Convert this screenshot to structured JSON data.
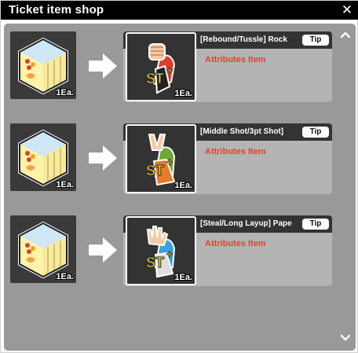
{
  "window": {
    "title": "Ticket item shop",
    "close_symbol": "✕"
  },
  "exchanges": [
    {
      "source_icon": "ticket-box-icon",
      "source_qty": "1Ea.",
      "result_icon": "rock-hand-character-icon",
      "result_qty": "1Ea.",
      "name": "[Rebound/Tussle] Rock",
      "tip": "Tip",
      "type": "Attributes Item"
    },
    {
      "source_icon": "ticket-box-icon",
      "source_qty": "1Ea.",
      "result_icon": "scissors-hand-character-icon",
      "result_qty": "1Ea.",
      "name": "[Middle Shot/3pt Shot]",
      "tip": "Tip",
      "type": "Attributes Item"
    },
    {
      "source_icon": "ticket-box-icon",
      "source_qty": "1Ea.",
      "result_icon": "paper-hand-character-icon",
      "result_qty": "1Ea.",
      "name": "[Steal/Long Layup] Pape",
      "tip": "Tip",
      "type": "Attributes Item"
    }
  ],
  "colors": {
    "title_bar": "#000000",
    "panel": "#999999",
    "card": "#b4b4b4",
    "attribute_text": "#e4402a"
  }
}
